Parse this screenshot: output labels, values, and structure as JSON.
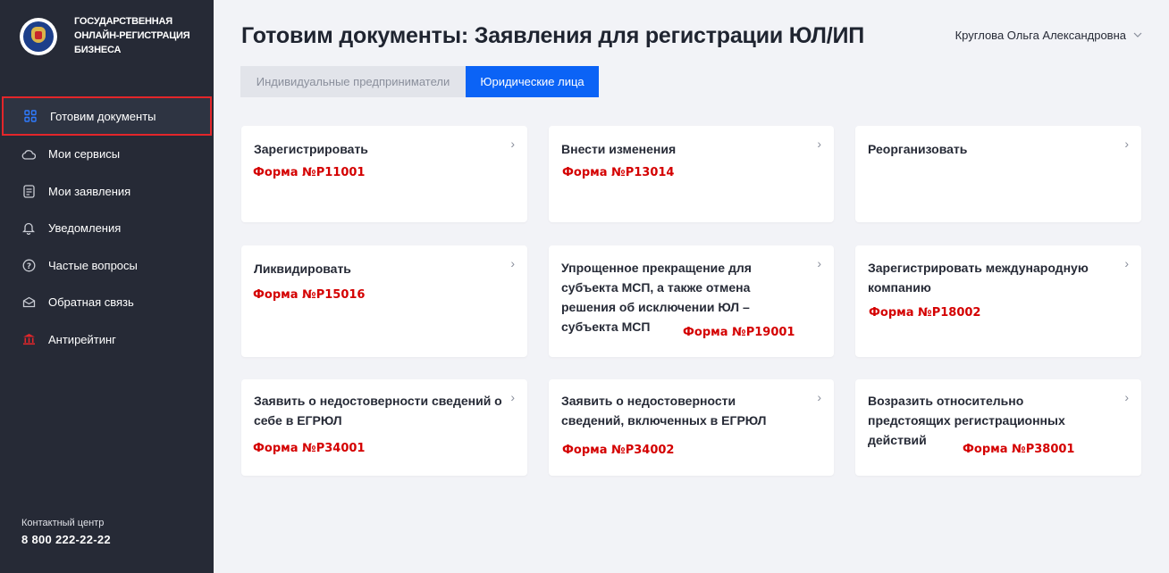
{
  "logo": {
    "lines": [
      "ГОСУДАРСТВЕННАЯ",
      "ОНЛАЙН-РЕГИСТРАЦИЯ",
      "БИЗНЕСА"
    ]
  },
  "sidebar": {
    "items": [
      {
        "label": "Готовим документы",
        "icon": "grid-icon"
      },
      {
        "label": "Мои сервисы",
        "icon": "cloud-icon"
      },
      {
        "label": "Мои заявления",
        "icon": "document-icon"
      },
      {
        "label": "Уведомления",
        "icon": "bell-icon"
      },
      {
        "label": "Частые вопросы",
        "icon": "question-icon"
      },
      {
        "label": "Обратная связь",
        "icon": "envelope-icon"
      },
      {
        "label": "Антирейтинг",
        "icon": "bank-icon"
      }
    ],
    "contact_label": "Контактный центр",
    "contact_phone": "8 800 222-22-22"
  },
  "header": {
    "title": "Готовим документы: Заявления для регистрации ЮЛ/ИП",
    "user_name": "Круглова Ольга Александровна"
  },
  "tabs": [
    {
      "label": "Индивидуальные предприниматели",
      "active": false
    },
    {
      "label": "Юридические лица",
      "active": true
    }
  ],
  "cards": [
    {
      "title": "Зарегистрировать",
      "form": "Форма №Р11001"
    },
    {
      "title": "Внести изменения",
      "form": "Форма №Р13014"
    },
    {
      "title": "Реорганизовать",
      "form": ""
    },
    {
      "title": "Ликвидировать",
      "form": "Форма №Р15016"
    },
    {
      "title": "Упрощенное прекращение для субъекта МСП, а также отмена решения об исключении ЮЛ – субъекта МСП",
      "form": "Форма №Р19001"
    },
    {
      "title": "Зарегистрировать международную компанию",
      "form": "Форма №Р18002"
    },
    {
      "title": "Заявить о недостоверности сведений о себе в ЕГРЮЛ",
      "form": "Форма №Р34001"
    },
    {
      "title": "Заявить о недостоверности сведений, включенных в ЕГРЮЛ",
      "form": "Форма №Р34002"
    },
    {
      "title": "Возразить относительно предстоящих регистрационных действий",
      "form": "Форма №Р38001"
    }
  ],
  "colors": {
    "accent": "#0b63f6",
    "sidebar_bg": "#262a36",
    "form_red": "#d40000",
    "highlight": "#e3262a"
  }
}
